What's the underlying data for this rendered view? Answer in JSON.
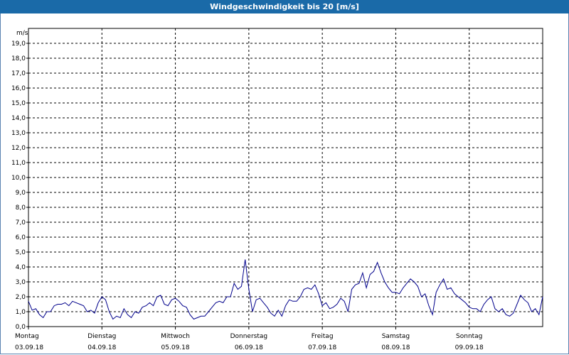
{
  "window": {
    "title": "Windgeschwindigkeit bis 20 [m/s]"
  },
  "chart_data": {
    "type": "line",
    "title": "Windgeschwindigkeit bis 20 [m/s]",
    "ylabel": "m/s",
    "ylim": [
      0,
      20
    ],
    "yticks": [
      "0,0",
      "1,0",
      "2,0",
      "3,0",
      "4,0",
      "5,0",
      "6,0",
      "7,0",
      "8,0",
      "9,0",
      "10,0",
      "11,0",
      "12,0",
      "13,0",
      "14,0",
      "15,0",
      "16,0",
      "17,0",
      "18,0",
      "19,0"
    ],
    "xlim": [
      0,
      7
    ],
    "days": [
      {
        "name": "Montag",
        "date": "03.09.18"
      },
      {
        "name": "Dienstag",
        "date": "04.09.18"
      },
      {
        "name": "Mittwoch",
        "date": "05.09.18"
      },
      {
        "name": "Donnerstag",
        "date": "06.09.18"
      },
      {
        "name": "Freitag",
        "date": "07.09.18"
      },
      {
        "name": "Samstag",
        "date": "08.09.18"
      },
      {
        "name": "Sonntag",
        "date": "09.09.18"
      }
    ],
    "grid": true,
    "series": [
      {
        "color": "#00008b",
        "x": [
          0.0,
          0.05,
          0.1,
          0.15,
          0.2,
          0.25,
          0.3,
          0.35,
          0.4,
          0.45,
          0.5,
          0.55,
          0.6,
          0.65,
          0.7,
          0.75,
          0.8,
          0.85,
          0.9,
          0.95,
          1.0,
          1.05,
          1.1,
          1.15,
          1.2,
          1.25,
          1.3,
          1.35,
          1.4,
          1.45,
          1.5,
          1.55,
          1.6,
          1.65,
          1.7,
          1.75,
          1.8,
          1.85,
          1.9,
          1.95,
          2.0,
          2.05,
          2.1,
          2.15,
          2.2,
          2.25,
          2.3,
          2.35,
          2.4,
          2.45,
          2.5,
          2.55,
          2.6,
          2.65,
          2.7,
          2.75,
          2.8,
          2.85,
          2.9,
          2.95,
          3.0,
          3.05,
          3.1,
          3.15,
          3.2,
          3.25,
          3.3,
          3.35,
          3.4,
          3.45,
          3.5,
          3.55,
          3.6,
          3.65,
          3.7,
          3.75,
          3.8,
          3.85,
          3.9,
          3.95,
          4.0,
          4.05,
          4.1,
          4.15,
          4.2,
          4.25,
          4.3,
          4.35,
          4.4,
          4.45,
          4.5,
          4.55,
          4.6,
          4.65,
          4.7,
          4.75,
          4.8,
          4.85,
          4.9,
          4.95,
          5.0,
          5.05,
          5.1,
          5.15,
          5.2,
          5.25,
          5.3,
          5.35,
          5.4,
          5.45,
          5.5,
          5.55,
          5.6,
          5.65,
          5.7,
          5.75,
          5.8,
          5.85,
          5.9,
          5.95,
          6.0,
          6.05,
          6.1,
          6.15,
          6.2,
          6.25,
          6.3,
          6.35,
          6.4,
          6.45,
          6.5,
          6.55,
          6.6,
          6.65,
          6.7,
          6.75,
          6.8,
          6.85,
          6.9,
          6.95,
          7.0
        ],
        "y": [
          1.7,
          1.1,
          1.2,
          0.8,
          0.6,
          1.0,
          1.0,
          1.4,
          1.5,
          1.5,
          1.6,
          1.4,
          1.7,
          1.6,
          1.5,
          1.4,
          1.0,
          1.1,
          0.9,
          1.6,
          2.0,
          1.8,
          1.0,
          0.5,
          0.7,
          0.6,
          1.2,
          0.8,
          0.6,
          1.0,
          0.9,
          1.3,
          1.4,
          1.6,
          1.4,
          2.0,
          2.1,
          1.5,
          1.4,
          1.8,
          1.9,
          1.7,
          1.4,
          1.3,
          0.8,
          0.5,
          0.6,
          0.7,
          0.7,
          1.0,
          1.3,
          1.6,
          1.7,
          1.6,
          2.0,
          2.0,
          2.9,
          2.5,
          2.7,
          4.5,
          2.5,
          1.0,
          1.8,
          1.9,
          1.6,
          1.3,
          0.9,
          0.7,
          1.1,
          0.7,
          1.4,
          1.8,
          1.7,
          1.7,
          2.0,
          2.5,
          2.6,
          2.5,
          2.8,
          2.2,
          1.4,
          1.6,
          1.2,
          1.3,
          1.5,
          1.9,
          1.7,
          1.0,
          2.5,
          2.8,
          2.9,
          3.6,
          2.6,
          3.5,
          3.7,
          4.3,
          3.6,
          3.0,
          2.6,
          2.3,
          2.3,
          2.2,
          2.6,
          2.9,
          3.2,
          3.0,
          2.7,
          2.0,
          2.2,
          1.4,
          0.8,
          2.3,
          2.8,
          3.2,
          2.5,
          2.6,
          2.2,
          2.0,
          1.8,
          1.6,
          1.3,
          1.2,
          1.2,
          1.0,
          1.5,
          1.8,
          2.0,
          1.2,
          1.0,
          1.2,
          0.8,
          0.7,
          0.9,
          1.5,
          2.1,
          1.8,
          1.6,
          1.0,
          1.2,
          0.8,
          2.0
        ]
      }
    ]
  }
}
